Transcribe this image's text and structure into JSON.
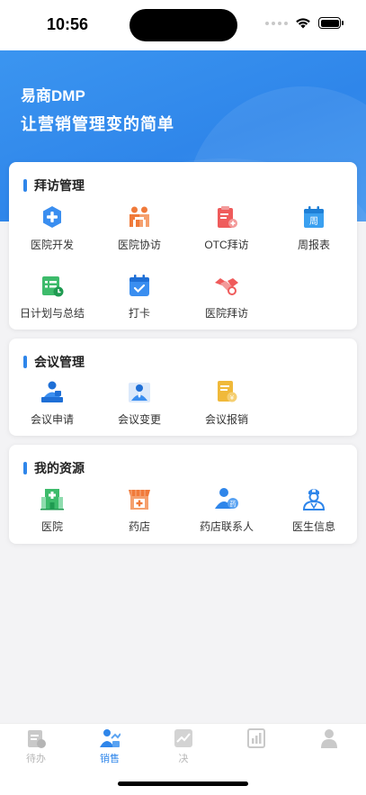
{
  "status_bar": {
    "time": "10:56"
  },
  "hero": {
    "title": "易商DMP",
    "subtitle": "让营销管理变的简单"
  },
  "sections": [
    {
      "title": "拜访管理",
      "items": [
        {
          "label": "医院开发",
          "icon": "hospital-plus-icon",
          "color": "#3a8ef0"
        },
        {
          "label": "医院协访",
          "icon": "people-collab-icon",
          "color": "#f07a3a"
        },
        {
          "label": "OTC拜访",
          "icon": "clipboard-visit-icon",
          "color": "#ef5b5b"
        },
        {
          "label": "周报表",
          "icon": "weekly-calendar-icon",
          "color": "#3aa0f0"
        },
        {
          "label": "日计划与总结",
          "icon": "daily-plan-icon",
          "color": "#3dbb6b"
        },
        {
          "label": "打卡",
          "icon": "check-in-icon",
          "color": "#3a8ef0"
        },
        {
          "label": "医院拜访",
          "icon": "handshake-icon",
          "color": "#ef5b5b"
        }
      ]
    },
    {
      "title": "会议管理",
      "items": [
        {
          "label": "会议申请",
          "icon": "meeting-apply-icon",
          "color": "#2f86ea"
        },
        {
          "label": "会议变更",
          "icon": "meeting-change-icon",
          "color": "#2f86ea"
        },
        {
          "label": "会议报销",
          "icon": "reimburse-icon",
          "color": "#f0b93a"
        }
      ]
    },
    {
      "title": "我的资源",
      "items": [
        {
          "label": "医院",
          "icon": "hospital-building-icon",
          "color": "#3dbb6b"
        },
        {
          "label": "药店",
          "icon": "pharmacy-store-icon",
          "color": "#f07a3a"
        },
        {
          "label": "药店联系人",
          "icon": "pharmacy-contact-icon",
          "color": "#2f86ea"
        },
        {
          "label": "医生信息",
          "icon": "doctor-icon",
          "color": "#2f86ea"
        }
      ]
    }
  ],
  "pharmacy_contact_badge": "药",
  "weekly_badge": "周",
  "tabs": [
    {
      "label": "待办",
      "icon": "todo-icon",
      "active": false
    },
    {
      "label": "销售",
      "icon": "sales-icon",
      "active": true
    },
    {
      "label": "决",
      "icon": "trend-icon",
      "active": false
    },
    {
      "label": "",
      "icon": "report-icon",
      "active": false
    },
    {
      "label": "",
      "icon": "profile-icon",
      "active": false
    }
  ],
  "colors": {
    "accent": "#2f86ea",
    "tab_inactive": "#b8b8b8"
  }
}
